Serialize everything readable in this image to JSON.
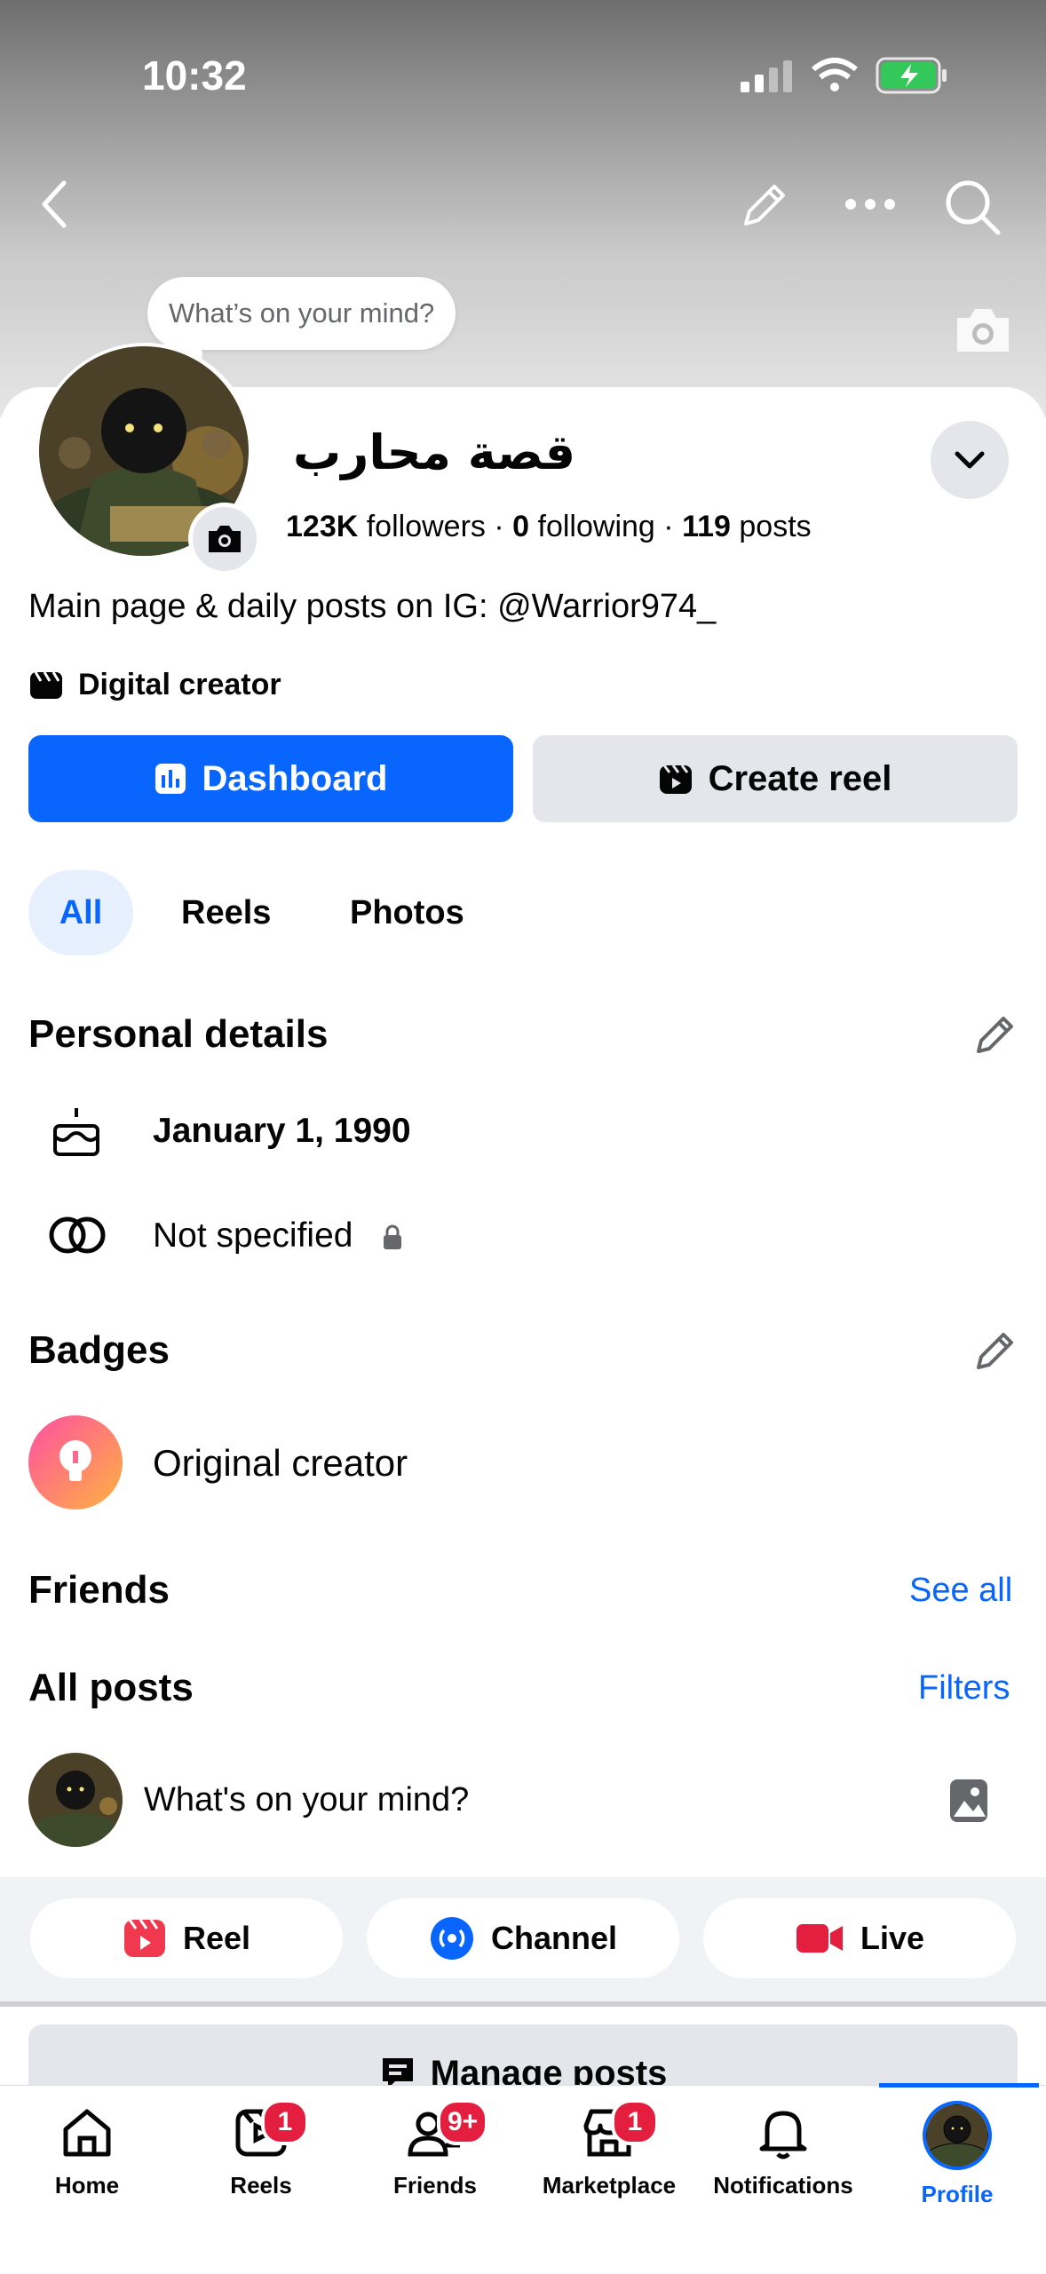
{
  "status_bar": {
    "time": "10:32"
  },
  "cover": {
    "composer_bubble": "What’s on your mind?"
  },
  "profile": {
    "name": "قصة محارب",
    "followers_count": "123K",
    "followers_label": "followers",
    "following_count": "0",
    "following_label": "following",
    "posts_count": "119",
    "posts_label": "posts",
    "bio": "Main page & daily posts on IG: @Warrior974_",
    "category": "Digital creator"
  },
  "actions": {
    "dashboard": "Dashboard",
    "create_reel": "Create reel"
  },
  "tabs": [
    {
      "label": "All"
    },
    {
      "label": "Reels"
    },
    {
      "label": "Photos"
    }
  ],
  "personal_details": {
    "title": "Personal details",
    "birthday": "January 1, 1990",
    "relationship": "Not specified"
  },
  "badges": {
    "title": "Badges",
    "item": "Original creator"
  },
  "friends": {
    "title": "Friends",
    "see_all": "See all"
  },
  "all_posts": {
    "title": "All posts",
    "filters": "Filters",
    "composer_placeholder": "What's on your mind?"
  },
  "post_types": [
    {
      "label": "Reel"
    },
    {
      "label": "Channel"
    },
    {
      "label": "Live"
    }
  ],
  "manage_posts": "Manage posts",
  "nav": [
    {
      "label": "Home"
    },
    {
      "label": "Reels",
      "badge": "1"
    },
    {
      "label": "Friends",
      "badge": "9+"
    },
    {
      "label": "Marketplace",
      "badge": "1"
    },
    {
      "label": "Notifications"
    },
    {
      "label": "Profile"
    }
  ],
  "colors": {
    "accent": "#0866ff",
    "badge": "#e41e3f",
    "panel": "#f0f2f5",
    "chip": "#e4e6eb"
  }
}
